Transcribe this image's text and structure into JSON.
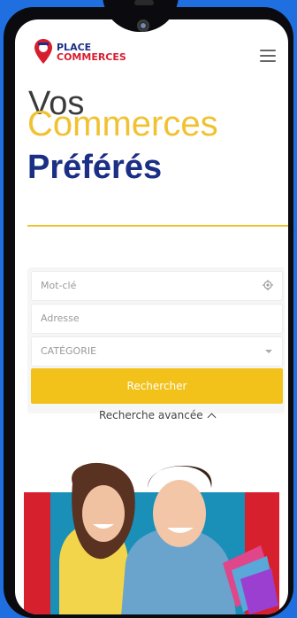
{
  "header": {
    "logo_line1": "PLACE",
    "logo_line2": "COMMERCES",
    "menu_icon": "hamburger-menu-icon"
  },
  "hero_heading": {
    "line1": "Vos",
    "line2": "Commerces",
    "line3": "Préférés"
  },
  "search": {
    "keyword_placeholder": "Mot-clé",
    "address_placeholder": "Adresse",
    "category_select_value": "CATÉGORIE",
    "submit_label": "Rechercher",
    "advanced_label": "Recherche avancée"
  },
  "colors": {
    "accent_yellow": "#f0c232",
    "brand_blue": "#1b2f86",
    "brand_red": "#d71e2f",
    "background_blue": "#1f6fe0"
  }
}
